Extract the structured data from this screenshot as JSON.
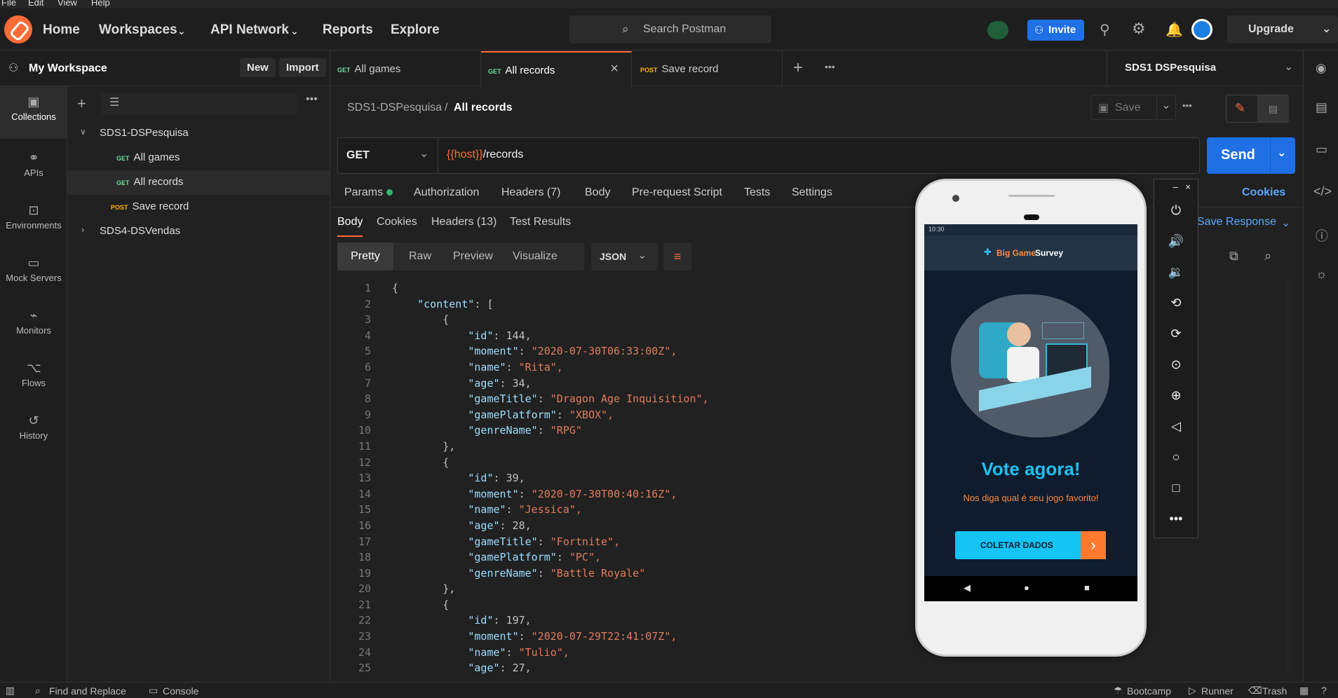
{
  "menu": [
    "File",
    "Edit",
    "View",
    "Help"
  ],
  "topnav": {
    "links": [
      "Home",
      "Workspaces",
      "API Network",
      "Reports",
      "Explore"
    ],
    "search_placeholder": "Search Postman",
    "invite_label": "Invite",
    "upgrade_label": "Upgrade"
  },
  "workspace": {
    "name": "My Workspace",
    "new_label": "New",
    "import_label": "Import"
  },
  "leftnav": [
    "Collections",
    "APIs",
    "Environments",
    "Mock Servers",
    "Monitors",
    "Flows",
    "History"
  ],
  "tree": {
    "collection1": "SDS1-DSPesquisa",
    "items": [
      {
        "method": "GET",
        "label": "All games"
      },
      {
        "method": "GET",
        "label": "All records"
      },
      {
        "method": "POST",
        "label": "Save record"
      }
    ],
    "collection2": "SDS4-DSVendas"
  },
  "tabs": [
    {
      "method": "GET",
      "label": "All games"
    },
    {
      "method": "GET",
      "label": "All records"
    },
    {
      "method": "POST",
      "label": "Save record"
    }
  ],
  "environment": "SDS1 DSPesquisa",
  "breadcrumb": {
    "collection": "SDS1-DSPesquisa",
    "sep": "/",
    "request": "All records"
  },
  "save_label": "Save",
  "request": {
    "method": "GET",
    "url_var": "{{host}}",
    "url_path": "/records",
    "send_label": "Send"
  },
  "request_tabs": [
    "Params",
    "Authorization",
    "Headers (7)",
    "Body",
    "Pre-request Script",
    "Tests",
    "Settings"
  ],
  "cookies_label": "Cookies",
  "response_tabs": [
    "Body",
    "Cookies",
    "Headers (13)",
    "Test Results"
  ],
  "save_response_label": "Save Response",
  "view_modes": [
    "Pretty",
    "Raw",
    "Preview",
    "Visualize"
  ],
  "format_label": "JSON",
  "code_lines": [
    "{",
    "    \"content\": [",
    "        {",
    "            \"id\": 144,",
    "            \"moment\": \"2020-07-30T06:33:00Z\",",
    "            \"name\": \"Rita\",",
    "            \"age\": 34,",
    "            \"gameTitle\": \"Dragon Age Inquisition\",",
    "            \"gamePlatform\": \"XBOX\",",
    "            \"genreName\": \"RPG\"",
    "        },",
    "        {",
    "            \"id\": 39,",
    "            \"moment\": \"2020-07-30T00:40:16Z\",",
    "            \"name\": \"Jessica\",",
    "            \"age\": 28,",
    "            \"gameTitle\": \"Fortnite\",",
    "            \"gamePlatform\": \"PC\",",
    "            \"genreName\": \"Battle Royale\"",
    "        },",
    "        {",
    "            \"id\": 197,",
    "            \"moment\": \"2020-07-29T22:41:07Z\",",
    "            \"name\": \"Tulio\",",
    "            \"age\": 27,"
  ],
  "statusbar": {
    "find": "Find and Replace",
    "console": "Console",
    "bootcamp": "Bootcamp",
    "runner": "Runner",
    "trash": "Trash"
  },
  "phone": {
    "time": "10:30",
    "app_title_a": "Big Game",
    "app_title_b": "Survey",
    "headline": "Vote agora!",
    "subtitle": "Nos diga qual é seu jogo favorito!",
    "button": "COLETAR DADOS"
  }
}
